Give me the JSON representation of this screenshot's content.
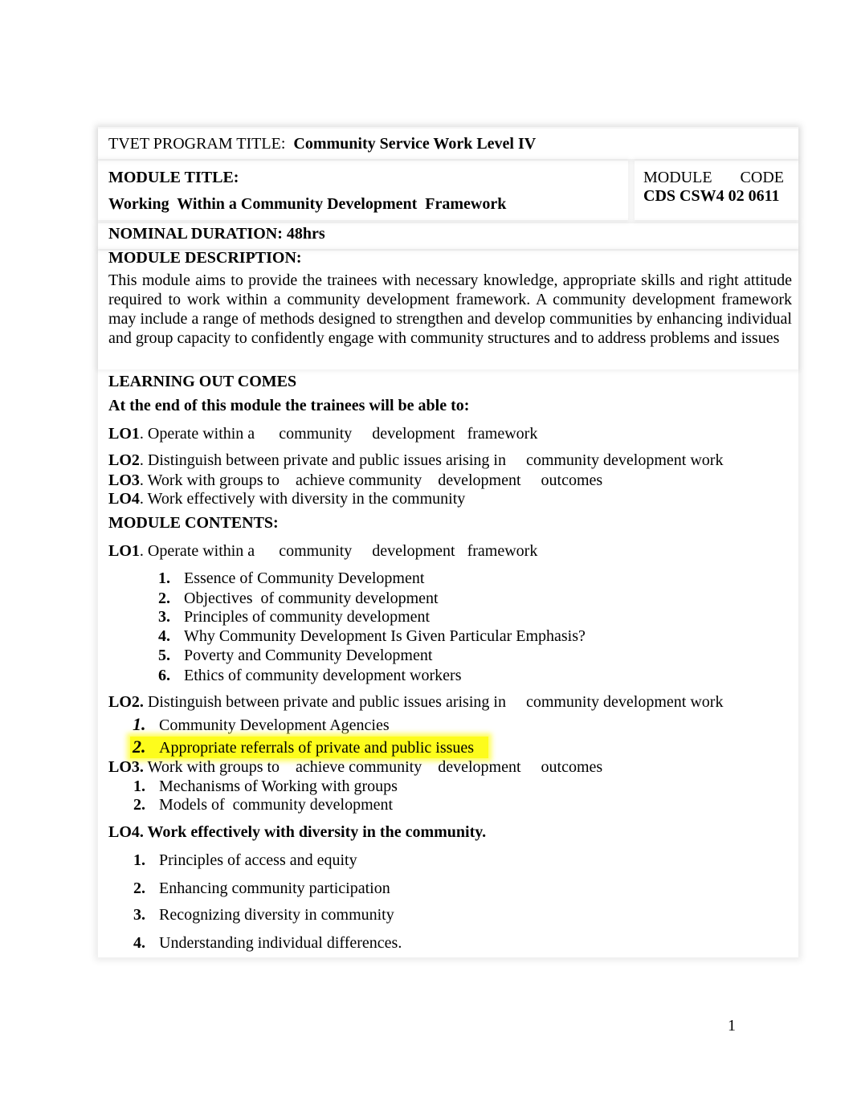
{
  "header": {
    "program_label": "TVET PROGRAM TITLE:  ",
    "program_title": "Community Service Work Level IV",
    "module_title_label": "MODULE TITLE:",
    "module_title": "Working  Within a Community Development  Framework",
    "module_code_label": "MODULE       CODE",
    "module_code": "CDS CSW4 02 0611",
    "nominal_duration": "NOMINAL DURATION: 48hrs"
  },
  "description": {
    "heading": "MODULE DESCRIPTION:",
    "text": "This module aims to provide the trainees with necessary knowledge, appropriate skills and right attitude required to work within a community development framework. A community development framework may include a range of methods designed to strengthen and develop communities by enhancing individual and group capacity to confidently engage with community structures and to address problems and issues"
  },
  "outcomes": {
    "heading": "LEARNING OUT COMES",
    "intro": "At the end of this module the trainees will be able to:",
    "items": [
      {
        "code": "LO1",
        "text": ". Operate within a      community     development   framework"
      },
      {
        "code": "LO2",
        "text": ". Distinguish between private and public issues arising in     community development work"
      },
      {
        "code": "LO3",
        "text": ". Work with groups to    achieve community    development     outcomes"
      },
      {
        "code": "LO4",
        "text": ". Work effectively with diversity in the community"
      }
    ]
  },
  "contents": {
    "heading": "MODULE CONTENTS:",
    "lo1": {
      "code": "LO1",
      "text": ". Operate within a      community     development   framework",
      "items": [
        {
          "num": "1.",
          "text": "Essence of Community Development"
        },
        {
          "num": "2.",
          "text": "Objectives  of community development"
        },
        {
          "num": "3.",
          "text": "Principles of community development"
        },
        {
          "num": "4.",
          "text": "Why Community Development Is Given Particular Emphasis?"
        },
        {
          "num": "5.",
          "text": "Poverty and Community Development"
        },
        {
          "num": "6.",
          "text": "Ethics of community development workers"
        }
      ]
    },
    "lo2": {
      "code": "LO2.",
      "text": " Distinguish between private and public issues arising in     community development work",
      "items": [
        {
          "num": "1.",
          "text": "Community Development Agencies"
        },
        {
          "num": "2.",
          "text": "Appropriate referrals of private and public issues",
          "highlighted": true
        }
      ],
      "highlight_color": "#fdfc1c"
    },
    "lo3": {
      "code": "LO3.",
      "text": " Work with groups to    achieve community    development     outcomes",
      "items": [
        {
          "num": "1.",
          "text": "Mechanisms of Working with groups"
        },
        {
          "num": "2.",
          "text": "Models of  community development"
        }
      ]
    },
    "lo4": {
      "heading": "LO4. Work effectively with diversity in the community.",
      "items": [
        {
          "num": "1.",
          "text": "Principles of access and equity"
        },
        {
          "num": "2.",
          "text": "Enhancing community participation"
        },
        {
          "num": "3.",
          "text": "Recognizing diversity in community"
        },
        {
          "num": "4.",
          "text": "Understanding individual differences."
        }
      ]
    }
  },
  "footer": {
    "page_number": "1"
  }
}
